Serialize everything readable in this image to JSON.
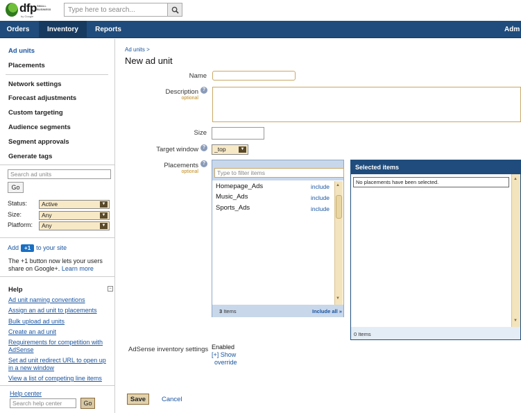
{
  "brand": {
    "logo": "dfp",
    "small_business": "SMALL BUSINESS",
    "by_google": "by Google"
  },
  "header": {
    "search_placeholder": "Type here to search..."
  },
  "nav": {
    "orders": "Orders",
    "inventory": "Inventory",
    "reports": "Reports",
    "admin": "Adm"
  },
  "sidebar": {
    "items": [
      "Ad units",
      "Placements",
      "Network settings",
      "Forecast adjustments",
      "Custom targeting",
      "Audience segments",
      "Segment approvals",
      "Generate tags"
    ],
    "search_placeholder": "Search ad units",
    "go": "Go",
    "filters": {
      "status_label": "Status:",
      "status_value": "Active",
      "size_label": "Size:",
      "size_value": "Any",
      "platform_label": "Platform:",
      "platform_value": "Any"
    },
    "plus": {
      "add": "Add",
      "badge": "+1",
      "to_site": "to your site",
      "desc": "The +1 button now lets your users share on Google+.",
      "learn_more": "Learn more"
    },
    "help": {
      "title": "Help",
      "links": [
        "Ad unit naming conventions",
        "Assign an ad unit to placements",
        "Bulk upload ad units",
        "Create an ad unit",
        "Requirements for competition with AdSense",
        "Set ad unit redirect URL to open up in a new window",
        "View a list of competing line items"
      ],
      "help_center": "Help center",
      "search_placeholder": "Search help center",
      "go": "Go"
    }
  },
  "main": {
    "breadcrumb": "Ad units >",
    "title": "New ad unit",
    "form": {
      "name_label": "Name",
      "description_label": "Description",
      "optional": "optional",
      "size_label": "Size",
      "target_window_label": "Target window",
      "target_window_value": "_top",
      "placements_label": "Placements"
    },
    "placements": {
      "filter_placeholder": "Type to filter items",
      "items": [
        "Homepage_Ads",
        "Music_Ads",
        "Sports_Ads"
      ],
      "include": "include",
      "count": "3",
      "items_word": "Items",
      "include_all": "Include all »"
    },
    "selected": {
      "title": "Selected items",
      "empty": "No placements have been selected.",
      "count": "0 Items"
    },
    "adsense": {
      "label": "AdSense inventory settings",
      "value": "Enabled",
      "show": "[+] Show",
      "override": "override"
    },
    "save": "Save",
    "cancel": "Cancel"
  }
}
